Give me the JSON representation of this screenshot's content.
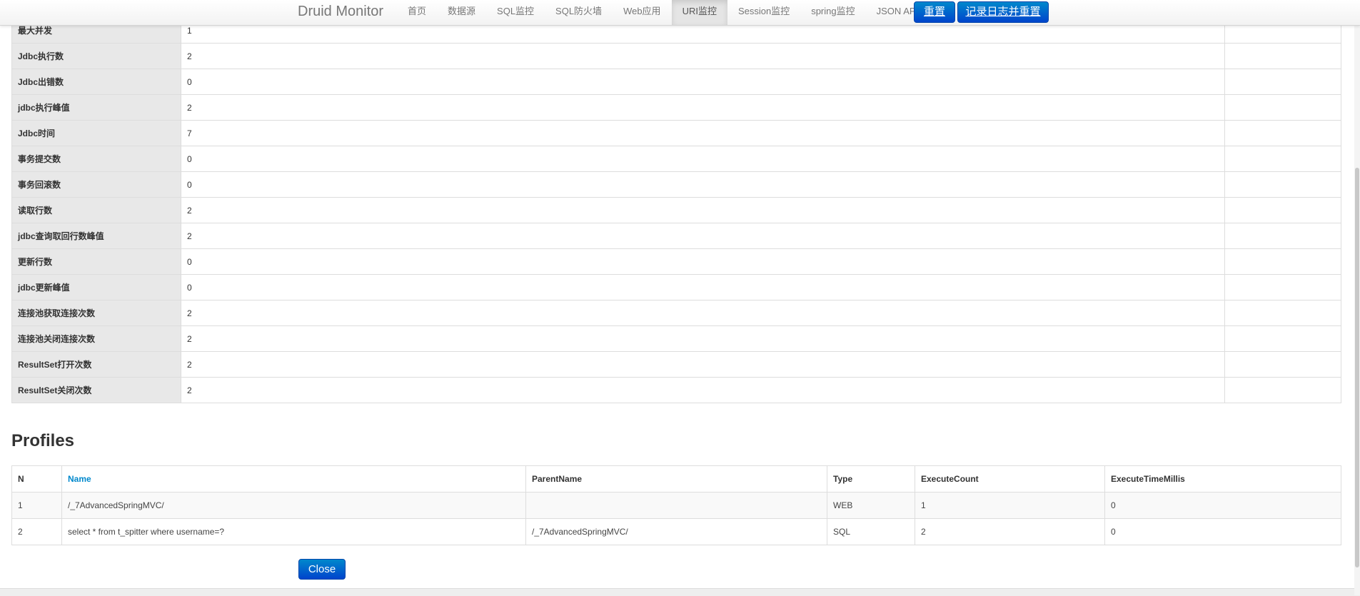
{
  "app": {
    "brand": "Druid Monitor"
  },
  "nav": {
    "items": [
      {
        "label": "首页"
      },
      {
        "label": "数据源"
      },
      {
        "label": "SQL监控"
      },
      {
        "label": "SQL防火墙"
      },
      {
        "label": "Web应用"
      },
      {
        "label": "URI监控",
        "active": true
      },
      {
        "label": "Session监控"
      },
      {
        "label": "spring监控"
      },
      {
        "label": "JSON API"
      }
    ],
    "reset_label": "重置",
    "log_reset_label": "记录日志并重置"
  },
  "stats": {
    "rows": [
      {
        "label": "最大并发",
        "value": "1"
      },
      {
        "label": "Jdbc执行数",
        "value": "2"
      },
      {
        "label": "Jdbc出错数",
        "value": "0"
      },
      {
        "label": "jdbc执行峰值",
        "value": "2"
      },
      {
        "label": "Jdbc时间",
        "value": "7"
      },
      {
        "label": "事务提交数",
        "value": "0"
      },
      {
        "label": "事务回滚数",
        "value": "0"
      },
      {
        "label": "读取行数",
        "value": "2"
      },
      {
        "label": "jdbc查询取回行数峰值",
        "value": "2"
      },
      {
        "label": "更新行数",
        "value": "0"
      },
      {
        "label": "jdbc更新峰值",
        "value": "0"
      },
      {
        "label": "连接池获取连接次数",
        "value": "2"
      },
      {
        "label": "连接池关闭连接次数",
        "value": "2"
      },
      {
        "label": "ResultSet打开次数",
        "value": "2"
      },
      {
        "label": "ResultSet关闭次数",
        "value": "2"
      }
    ]
  },
  "profiles": {
    "title": "Profiles",
    "columns": [
      "N",
      "Name",
      "ParentName",
      "Type",
      "ExecuteCount",
      "ExecuteTimeMillis"
    ],
    "rows": [
      [
        "1",
        "/_7AdvancedSpringMVC/",
        "",
        "WEB",
        "1",
        "0"
      ],
      [
        "2",
        "select * from t_spitter where username=?",
        "/_7AdvancedSpringMVC/",
        "SQL",
        "2",
        "0"
      ]
    ]
  },
  "close_label": "Close"
}
